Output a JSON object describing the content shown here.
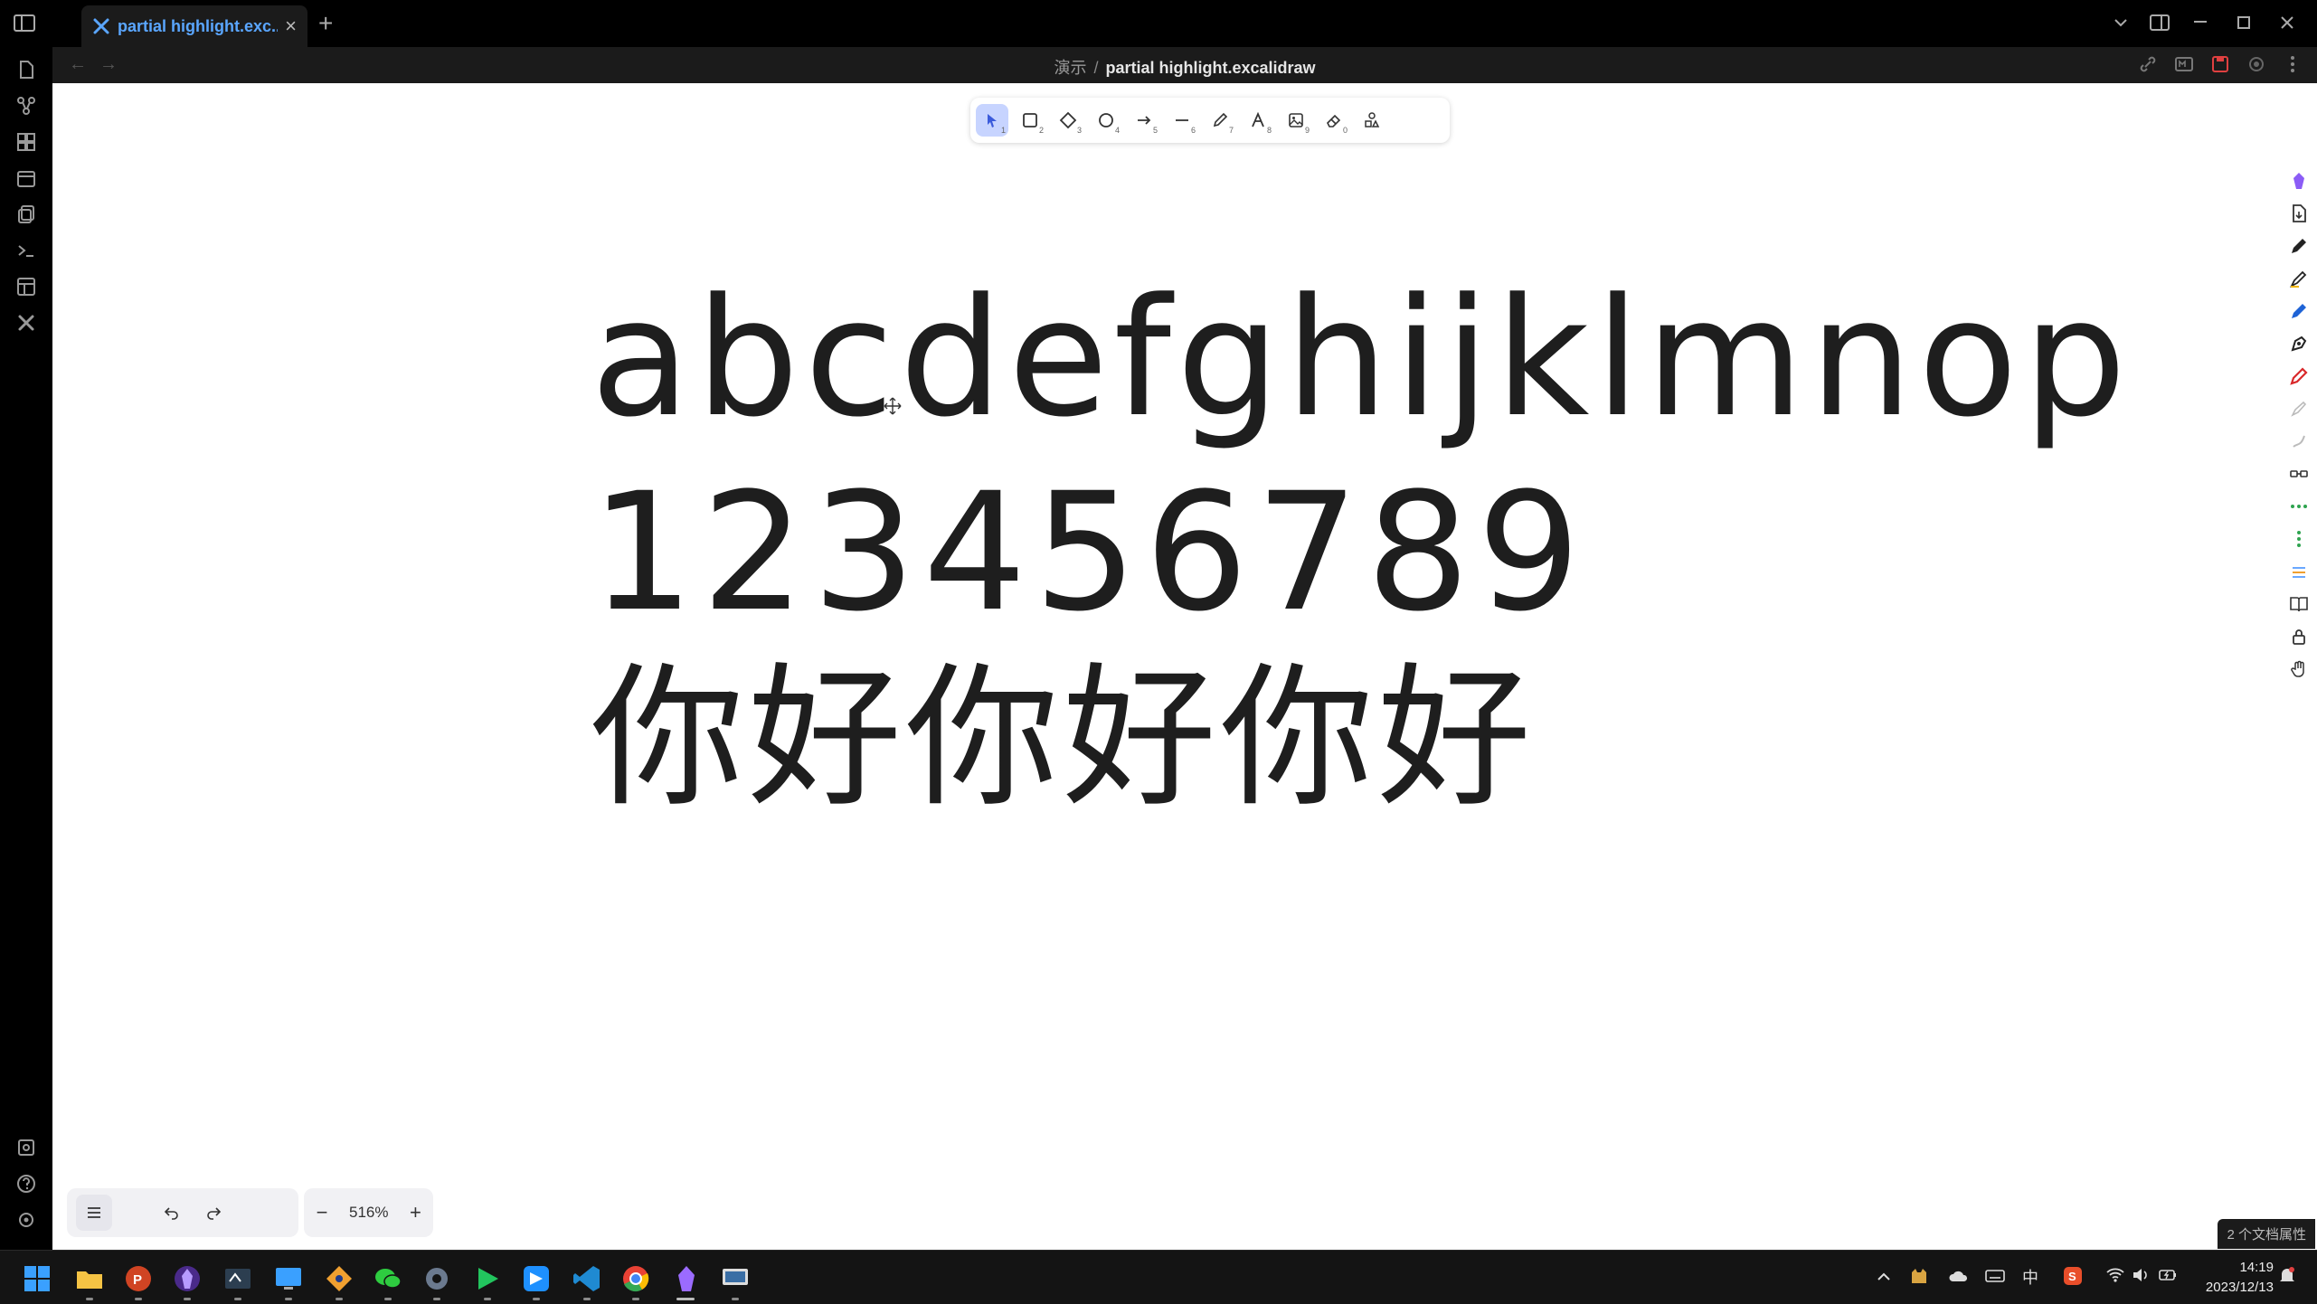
{
  "window": {
    "tab_title": "partial highlight.exc...",
    "tab_close": "×",
    "new_tab": "+"
  },
  "breadcrumb": {
    "folder": "演示",
    "separator": "/",
    "file": "partial highlight.excalidraw"
  },
  "tools": [
    {
      "name": "selection",
      "key": "1"
    },
    {
      "name": "rectangle",
      "key": "2"
    },
    {
      "name": "diamond",
      "key": "3"
    },
    {
      "name": "ellipse",
      "key": "4"
    },
    {
      "name": "arrow",
      "key": "5"
    },
    {
      "name": "line",
      "key": "6"
    },
    {
      "name": "draw",
      "key": "7"
    },
    {
      "name": "text",
      "key": "8"
    },
    {
      "name": "image",
      "key": "9"
    },
    {
      "name": "eraser",
      "key": "0"
    },
    {
      "name": "library",
      "key": ""
    }
  ],
  "canvas_text": {
    "line1": "abcdefghijklmnop",
    "line2": "123456789",
    "line3": "你好你好你好"
  },
  "bottom": {
    "zoom": "516%",
    "zoom_out": "−",
    "zoom_in": "+"
  },
  "status_badge": "2 个文档属性",
  "taskbar": {
    "tray_ime": "中",
    "time": "14:19",
    "date": "2023/12/13"
  },
  "colors": {
    "accent": "#5aa6ff",
    "tool_active": "#c7d4ff",
    "ink": "#1e1e1e"
  }
}
